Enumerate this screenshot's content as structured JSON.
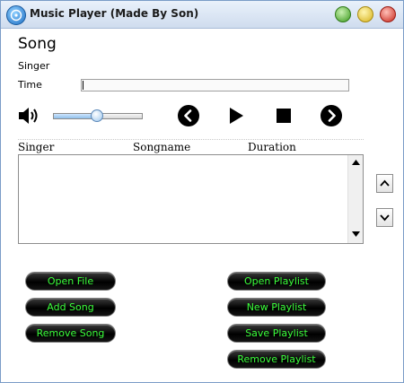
{
  "window": {
    "title": "Music Player (Made By Son)",
    "icon": "music-disc-icon"
  },
  "player": {
    "song_label": "Song",
    "singer_label": "Singer",
    "time_label": "Time",
    "time_value": "",
    "volume_level_percent": 50
  },
  "controls": {
    "icons": [
      "previous-icon",
      "play-icon",
      "stop-icon",
      "next-icon"
    ]
  },
  "playlist": {
    "columns": [
      "Singer",
      "Songname",
      "Duration"
    ],
    "rows": []
  },
  "buttons": {
    "open_file": "Open File",
    "add_song": "Add Song",
    "remove_song": "Remove Song",
    "open_playlist": "Open Playlist",
    "new_playlist": "New Playlist",
    "save_playlist": "Save Playlist",
    "remove_playlist": "Remove Playlist"
  },
  "colors": {
    "button_text": "#3bff3b",
    "button_bg": "#000000",
    "titlebar": "#dbe6f4"
  }
}
